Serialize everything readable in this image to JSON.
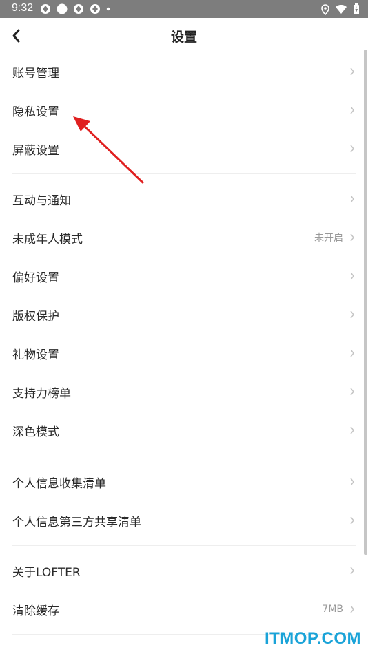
{
  "status_bar": {
    "time": "9:32"
  },
  "header": {
    "title": "设置"
  },
  "groups": [
    [
      {
        "label": "账号管理",
        "value": ""
      },
      {
        "label": "隐私设置",
        "value": ""
      },
      {
        "label": "屏蔽设置",
        "value": ""
      }
    ],
    [
      {
        "label": "互动与通知",
        "value": ""
      },
      {
        "label": "未成年人模式",
        "value": "未开启"
      },
      {
        "label": "偏好设置",
        "value": ""
      },
      {
        "label": "版权保护",
        "value": ""
      },
      {
        "label": "礼物设置",
        "value": ""
      },
      {
        "label": "支持力榜单",
        "value": ""
      },
      {
        "label": "深色模式",
        "value": ""
      }
    ],
    [
      {
        "label": "个人信息收集清单",
        "value": ""
      },
      {
        "label": "个人信息第三方共享清单",
        "value": ""
      }
    ],
    [
      {
        "label": "关于LOFTER",
        "value": ""
      },
      {
        "label": "清除缓存",
        "value": "7MB"
      }
    ]
  ],
  "watermark": "ITMOP.COM",
  "colors": {
    "arrow": "#e02020",
    "watermark": "#1aa3d8",
    "statusbar": "#7d7d7d"
  }
}
